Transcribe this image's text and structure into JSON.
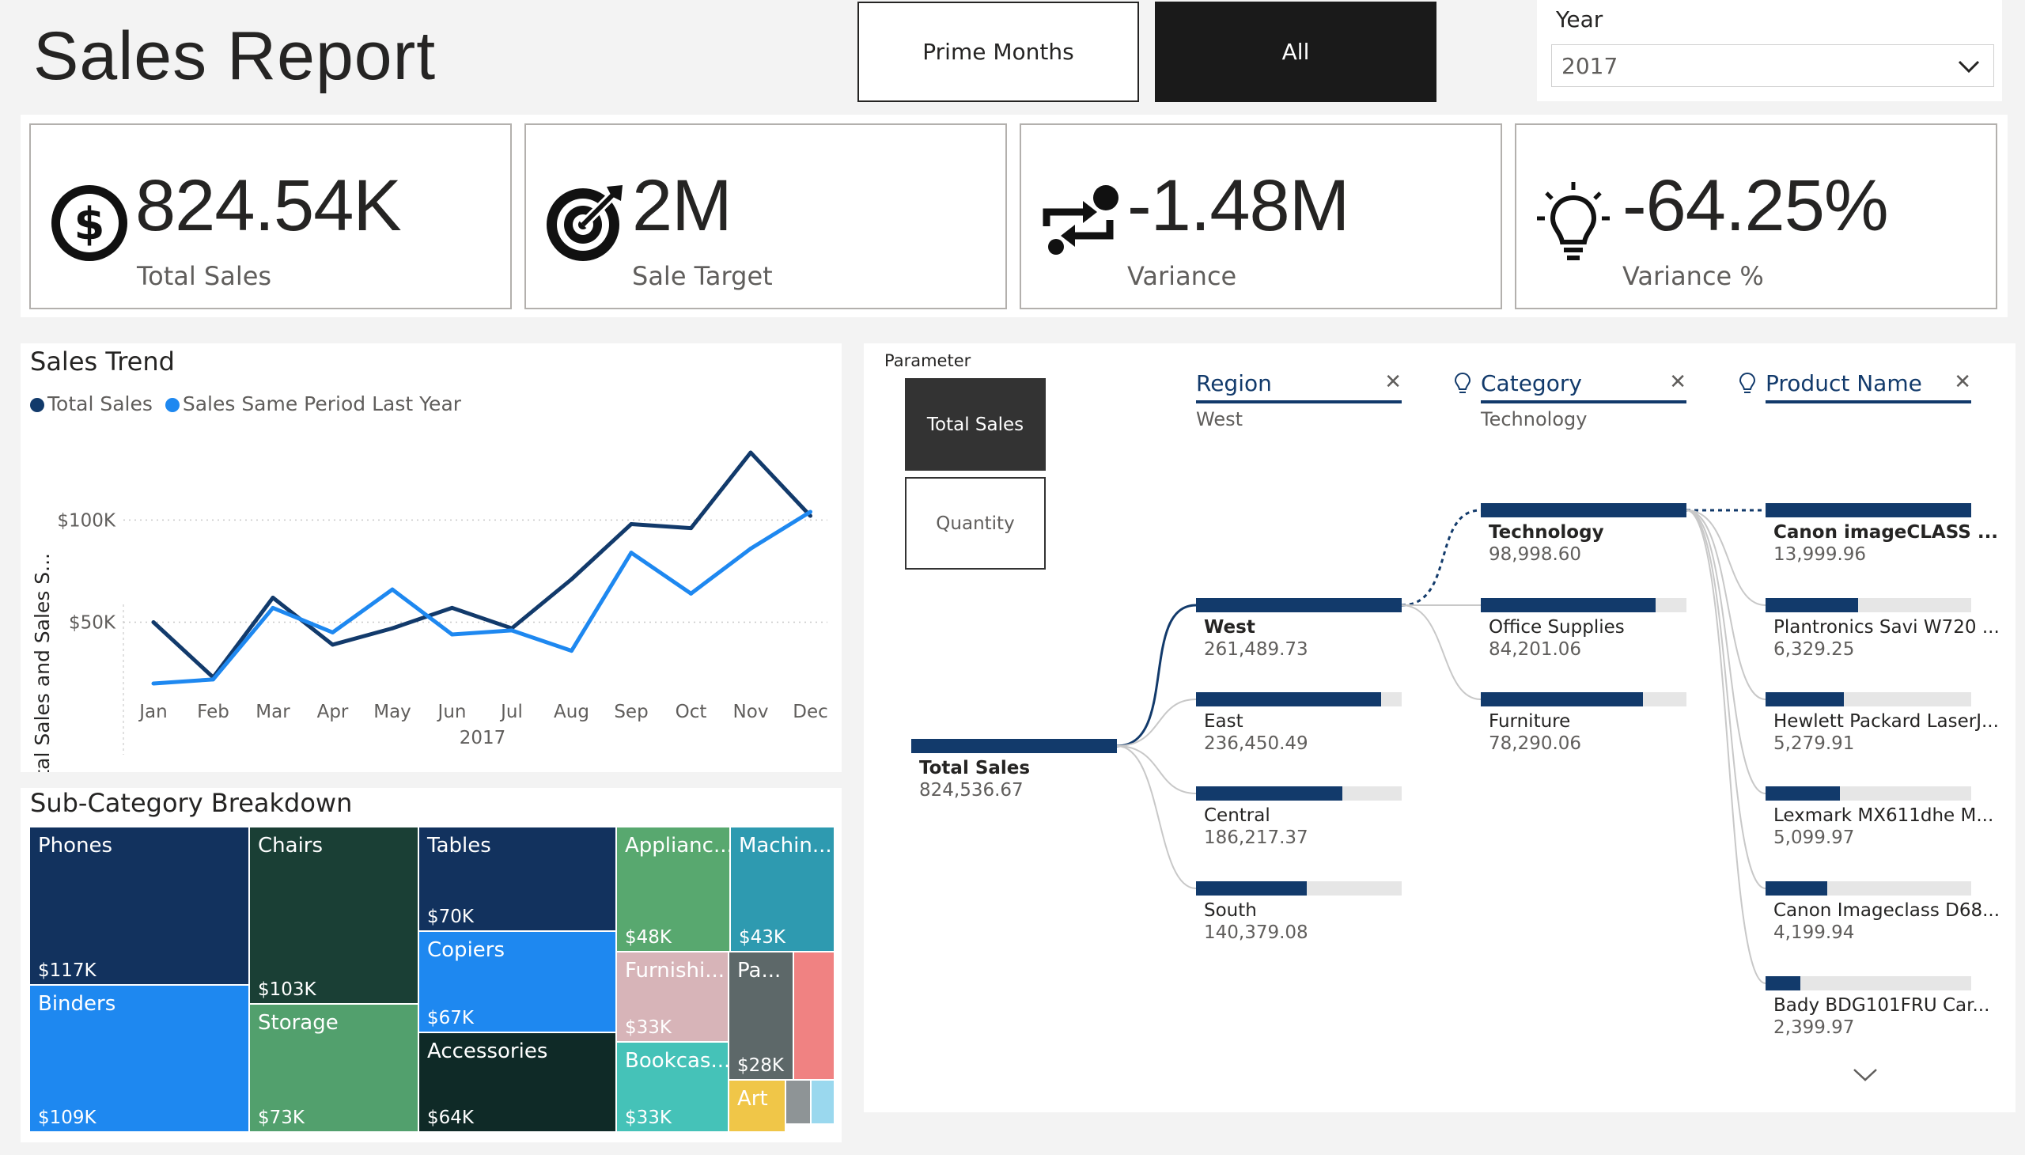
{
  "header": {
    "title": "Sales Report",
    "btn_prime": "Prime Months",
    "btn_all": "All"
  },
  "year_slicer": {
    "label": "Year",
    "selected": "2017"
  },
  "kpis": [
    {
      "value": "824.54K",
      "label": "Total Sales",
      "icon": "dollar-icon"
    },
    {
      "value": "2M",
      "label": "Sale Target",
      "icon": "target-icon"
    },
    {
      "value": "-1.48M",
      "label": "Variance",
      "icon": "exchange-icon"
    },
    {
      "value": "-64.25%",
      "label": "Variance %",
      "icon": "lightbulb-icon"
    }
  ],
  "colors": {
    "dark_navy": "#123a6b",
    "blue": "#1e88f0",
    "accent_black": "#1a1a1a"
  },
  "sales_trend": {
    "title": "Sales Trend",
    "legend": [
      "Total Sales",
      "Sales Same Period Last Year"
    ]
  },
  "chart_data": {
    "type": "line",
    "title": "Sales Trend",
    "xlabel": "2017",
    "ylabel": "Total Sales and Sales S...",
    "categories": [
      "Jan",
      "Feb",
      "Mar",
      "Apr",
      "May",
      "Jun",
      "Jul",
      "Aug",
      "Sep",
      "Oct",
      "Nov",
      "Dec"
    ],
    "yticks": [
      "$50K",
      "$100K"
    ],
    "ylim": [
      20000,
      140000
    ],
    "series": [
      {
        "name": "Total Sales",
        "color": "#123a6b",
        "values": [
          50000,
          23000,
          62000,
          39000,
          47000,
          57000,
          47000,
          71000,
          98000,
          96000,
          133000,
          102000
        ]
      },
      {
        "name": "Sales Same Period Last Year",
        "color": "#1e88f0",
        "values": [
          20000,
          22000,
          57000,
          45000,
          66000,
          44000,
          46000,
          36000,
          84000,
          64000,
          86000,
          104000
        ]
      }
    ],
    "grid": true
  },
  "subcategory": {
    "title": "Sub-Category Breakdown",
    "tiles": [
      {
        "name": "Phones",
        "value": "$117K",
        "color": "#12325e"
      },
      {
        "name": "Binders",
        "value": "$109K",
        "color": "#1e88f0"
      },
      {
        "name": "Chairs",
        "value": "$103K",
        "color": "#1a3f35"
      },
      {
        "name": "Storage",
        "value": "$73K",
        "color": "#52a06d"
      },
      {
        "name": "Tables",
        "value": "$70K",
        "color": "#12325e"
      },
      {
        "name": "Copiers",
        "value": "$67K",
        "color": "#1e88f0"
      },
      {
        "name": "Accessories",
        "value": "$64K",
        "color": "#0f2a27"
      },
      {
        "name": "Applianc...",
        "value": "$48K",
        "color": "#58a86f"
      },
      {
        "name": "Machin...",
        "value": "$43K",
        "color": "#2e9ab0"
      },
      {
        "name": "Furnishi...",
        "value": "$33K",
        "color": "#d7b4b8"
      },
      {
        "name": "Bookcas...",
        "value": "$33K",
        "color": "#45c2b8"
      },
      {
        "name": "Pa...",
        "value": "$28K",
        "color": "#5d6869"
      },
      {
        "name": "Art",
        "value": "",
        "color": "#f0c648"
      },
      {
        "name": "",
        "value": "",
        "color": "#f08282"
      },
      {
        "name": "",
        "value": "",
        "color": "#8e9496"
      },
      {
        "name": "",
        "value": "",
        "color": "#9ad8ee"
      }
    ]
  },
  "decomp": {
    "parameter_label": "Parameter",
    "param_options": [
      "Total Sales",
      "Quantity"
    ],
    "root": {
      "name": "Total Sales",
      "value": "824,536.67"
    },
    "levels": [
      {
        "title": "Region",
        "selected": "West"
      },
      {
        "title": "Category",
        "selected": "Technology"
      },
      {
        "title": "Product Name",
        "selected": ""
      }
    ],
    "regions": [
      {
        "name": "West",
        "value": "261,489.73",
        "fill": 1.0
      },
      {
        "name": "East",
        "value": "236,450.49",
        "fill": 0.9
      },
      {
        "name": "Central",
        "value": "186,217.37",
        "fill": 0.71
      },
      {
        "name": "South",
        "value": "140,379.08",
        "fill": 0.54
      }
    ],
    "categories": [
      {
        "name": "Technology",
        "value": "98,998.60",
        "fill": 1.0
      },
      {
        "name": "Office Supplies",
        "value": "84,201.06",
        "fill": 0.85
      },
      {
        "name": "Furniture",
        "value": "78,290.06",
        "fill": 0.79
      }
    ],
    "products": [
      {
        "name": "Canon imageCLASS ...",
        "value": "13,999.96",
        "fill": 1.0
      },
      {
        "name": "Plantronics Savi W720 ...",
        "value": "6,329.25",
        "fill": 0.45
      },
      {
        "name": "Hewlett Packard LaserJ...",
        "value": "5,279.91",
        "fill": 0.38
      },
      {
        "name": "Lexmark MX611dhe M...",
        "value": "5,099.97",
        "fill": 0.36
      },
      {
        "name": "Canon Imageclass D68...",
        "value": "4,199.94",
        "fill": 0.3
      },
      {
        "name": "Bady BDG101FRU Car...",
        "value": "2,399.97",
        "fill": 0.17
      }
    ]
  }
}
